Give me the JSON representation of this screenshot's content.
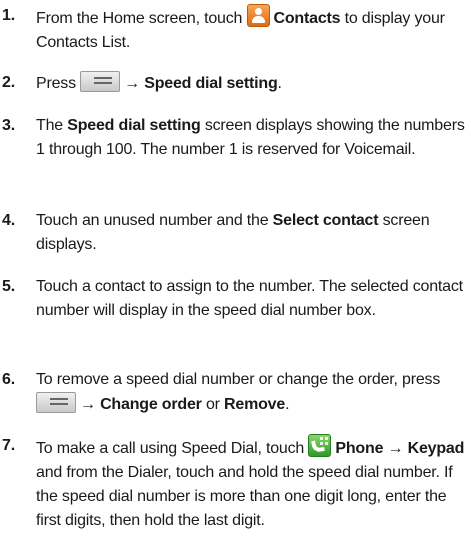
{
  "steps": [
    {
      "number": "1.",
      "t1": "From the Home screen, touch",
      "b1": "Contacts",
      "t2": "to display your Contacts List.",
      "icon": "contacts-icon"
    },
    {
      "number": "2.",
      "t1": "Press",
      "arrow": "→",
      "b1": "Speed dial setting",
      "t2": ".",
      "icon": "menu-key-icon"
    },
    {
      "number": "3.",
      "t1": "The",
      "b1": "Speed dial setting",
      "t2": "screen displays showing the numbers 1 through 100. The number 1 is reserved for Voicemail."
    },
    {
      "number": "4.",
      "t1": "Touch an unused number and the",
      "b1": "Select contact",
      "t2": "screen displays."
    },
    {
      "number": "5.",
      "t1": "Touch a contact to assign to the number. The selected contact number will display in the speed dial number box."
    },
    {
      "number": "6.",
      "t1": "To remove a speed dial number or change the order, press",
      "arrow": "→",
      "b1": "Change order",
      "t2": "or",
      "b2": "Remove",
      "t3": ".",
      "icon": "menu-key-icon"
    },
    {
      "number": "7.",
      "t1": "To make a call using Speed Dial, touch",
      "b1": "Phone",
      "arrow": "→",
      "b2": "Keypad",
      "t2": "and from the Dialer, touch and hold the speed dial number. If the speed dial number is more than one digit long, enter the first digits, then hold the last digit.",
      "icon": "phone-icon"
    }
  ]
}
